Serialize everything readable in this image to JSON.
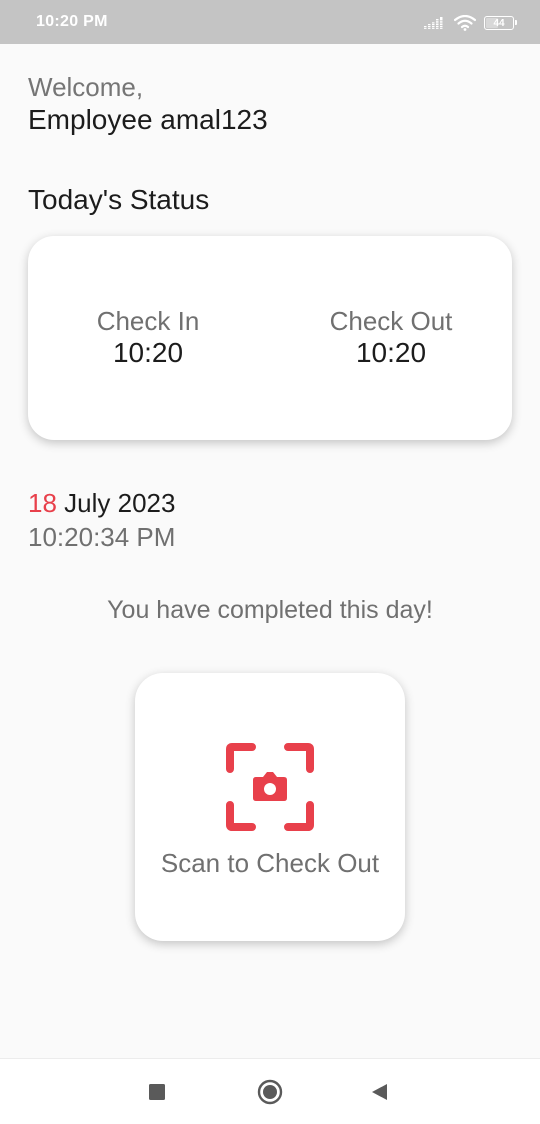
{
  "status_bar": {
    "time": "10:20 PM",
    "battery": "44",
    "icons": [
      "signal-icon",
      "wifi-icon",
      "battery-icon"
    ]
  },
  "greeting": {
    "welcome": "Welcome,",
    "user": "Employee amal123"
  },
  "today_status": {
    "title": "Today's Status",
    "check_in_label": "Check In",
    "check_in_time": "10:20",
    "check_out_label": "Check Out",
    "check_out_time": "10:20"
  },
  "date": {
    "day": "18",
    "month_year": "July 2023",
    "time": "10:20:34 PM"
  },
  "message": "You have completed this day!",
  "scan": {
    "label": "Scan to Check Out",
    "icon": "camera-scan-icon"
  },
  "nav": {
    "buttons": [
      "recents-icon",
      "home-icon",
      "back-icon"
    ]
  },
  "colors": {
    "accent": "#e8404b",
    "status_bar": "#c4c4c4",
    "background": "#fafafa"
  }
}
